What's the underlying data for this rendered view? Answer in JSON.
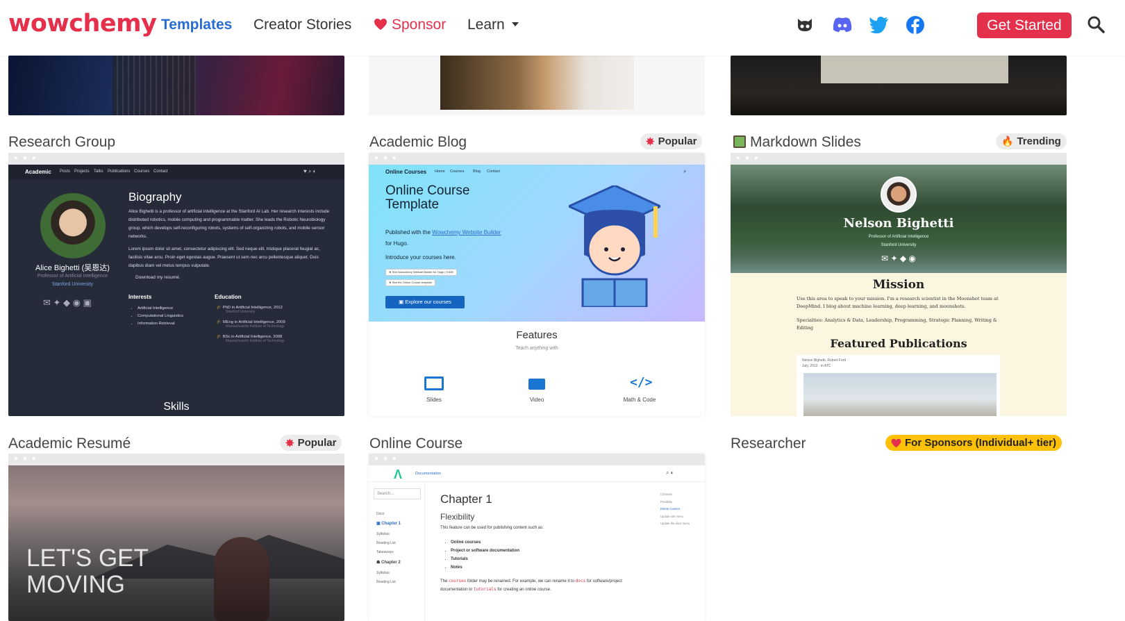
{
  "brand": "wowchemy",
  "nav": {
    "templates": "Templates",
    "creator_stories": "Creator Stories",
    "sponsor": "Sponsor",
    "learn": "Learn",
    "get_started": "Get Started"
  },
  "social_icons": [
    "github-icon",
    "discord-icon",
    "twitter-icon",
    "facebook-icon"
  ],
  "colors": {
    "brand": "#e5304c",
    "active_link": "#2a6bd1",
    "sponsor_badge": "#ffc107"
  },
  "cards": {
    "research_group": {
      "title": "Research Group",
      "preview": {
        "site_name": "Academic",
        "menu": [
          "Posts",
          "Projects",
          "Talks",
          "Publications",
          "Courses",
          "Contact"
        ],
        "person": "Alice Bighetti (吴恩达)",
        "role": "Professor of Artificial Intelligence",
        "org": "Stanford University",
        "bio_heading": "Biography",
        "bio_text": "Alice Bighetti is a professor of artificial intelligence at the Stanford AI Lab. Her research interests include distributed robotics, mobile computing and programmable matter. She leads the Robotic Neurobiology group, which develops self-reconfiguring robots, systems of self-organizing robots, and mobile sensor networks.",
        "bio_text2": "Lorem ipsum dolor sit amet, consectetur adipiscing elit. Sed neque elit, tristique placerat feugiat ac, facilisis vitae arcu. Proin eget egestas augue. Praesent ut sem nec arcu pellentesque aliquet. Duis dapibus diam vel metus tempus vulputate.",
        "download": "Download my resumé.",
        "interests_heading": "Interests",
        "interests": [
          "Artificial Intelligence",
          "Computational Linguistics",
          "Information Retrieval"
        ],
        "education_heading": "Education",
        "education": [
          {
            "degree": "PhD in Artificial Intelligence, 2012",
            "school": "Stanford University"
          },
          {
            "degree": "MEng in Artificial Intelligence, 2009",
            "school": "Massachusetts Institute of Technology"
          },
          {
            "degree": "BSc in Artificial Intelligence, 2008",
            "school": "Massachusetts Institute of Technology"
          }
        ],
        "skills": "Skills"
      }
    },
    "academic_blog": {
      "title": "Academic Blog",
      "badge": "Popular",
      "preview": {
        "site_name": "Online Courses",
        "menu": [
          "Home",
          "Courses",
          "Blog",
          "Contact"
        ],
        "heading": "Online Course Template",
        "published": "Published with the",
        "builder_link": "Wowchemy Website Builder",
        "for_hugo": "for Hugo.",
        "intro": "Introduce your courses here.",
        "star1": "Star Wowchemy Website Builder for Hugo",
        "star1_count": "5,638",
        "star2": "Star the Online Course template",
        "cta": "Explore our courses",
        "features_heading": "Features",
        "features_sub_prefix": "Teach ",
        "features_sub_em": "anything",
        "features_sub_suffix": " with",
        "features": [
          "Slides",
          "Video",
          "Math & Code"
        ]
      }
    },
    "markdown_slides": {
      "title": "Markdown Slides",
      "badge": "Trending",
      "preview": {
        "name": "Nelson Bighetti",
        "role": "Professor of Artificial Intelligence",
        "org": "Stanford University",
        "mission_heading": "Mission",
        "mission_text": "Use this area to speak to your mission. I'm a research scientist in the Moonshot team at DeepMind. I blog about machine learning, deep learning, and moonshots.",
        "specialties": "Specialties: Analytics & Data, Leadership, Programming, Strategic Planning, Writing & Editing",
        "pubs_heading": "Featured Publications",
        "pub_authors": "Nelson Bighetti, Robert Ford",
        "pub_date": "July, 2013",
        "pub_read": "in ATC"
      }
    },
    "academic_resume": {
      "title": "Academic Resumé",
      "badge": "Popular",
      "preview": {
        "overlay": "LET'S GET MOVING"
      }
    },
    "online_course": {
      "title": "Online Course",
      "preview": {
        "site_name": "Documentation",
        "search": "Search...",
        "nav": [
          "Docs",
          "Chapter 1",
          "Syllabus",
          "Reading List",
          "Takeaways",
          "Chapter 2",
          "Syllabus",
          "Reading List"
        ],
        "chapter": "Chapter 1",
        "sub": "Flexibility",
        "desc": "This feature can be used for publishing content such as:",
        "items": [
          "Online courses",
          "Project or software documentation",
          "Tutorials",
          "Notes"
        ],
        "note_a": "The",
        "note_code1": "courses",
        "note_b": "folder may be renamed. For example, we can rename it to",
        "note_code2": "docs",
        "note_c": "for software/project documentation or",
        "note_code3": "tutorials",
        "note_d": "for creating an online course.",
        "toc": [
          "Contents",
          "Flexibility",
          "Delete courses",
          "Update site menu",
          "Update the docs menu"
        ]
      }
    },
    "researcher": {
      "title": "Researcher",
      "badge": "For Sponsors (Individual+ tier)"
    }
  }
}
